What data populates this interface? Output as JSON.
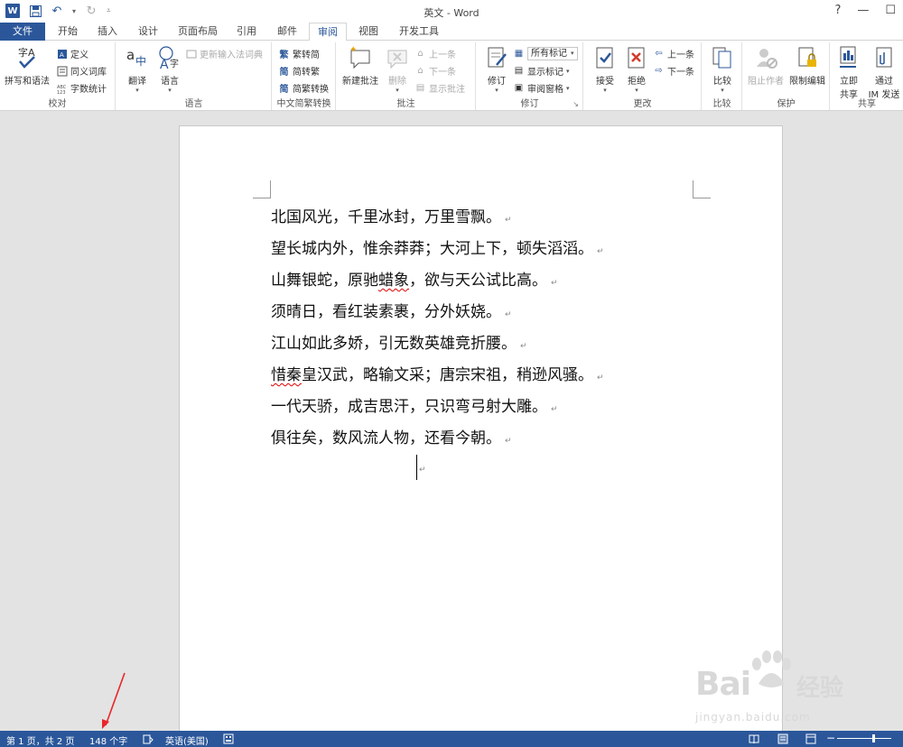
{
  "window": {
    "title": "英文 - Word",
    "help": "?",
    "minimize": "—",
    "maximize": "☐"
  },
  "tabs": [
    {
      "label": "文件"
    },
    {
      "label": "开始"
    },
    {
      "label": "插入"
    },
    {
      "label": "设计"
    },
    {
      "label": "页面布局"
    },
    {
      "label": "引用"
    },
    {
      "label": "邮件"
    },
    {
      "label": "审阅"
    },
    {
      "label": "视图"
    },
    {
      "label": "开发工具"
    }
  ],
  "ribbon": {
    "proofing": {
      "label": "校对",
      "spelling": "拼写和语法",
      "define": "定义",
      "thesaurus": "同义词库",
      "word_count": "字数统计"
    },
    "language": {
      "label": "语言",
      "translate": "翻译",
      "language": "语言",
      "update_ime": "更新输入法词典"
    },
    "chinese_conversion": {
      "label": "中文简繁转换",
      "to_simplified": "繁转简",
      "to_traditional": "简转繁",
      "convert": "简繁转换"
    },
    "comments": {
      "label": "批注",
      "new_comment": "新建批注",
      "delete": "删除",
      "previous": "上一条",
      "next": "下一条",
      "show_comments": "显示批注"
    },
    "tracking": {
      "label": "修订",
      "track_changes": "修订",
      "markup_select": "所有标记",
      "show_markup": "显示标记",
      "reviewing_pane": "审阅窗格"
    },
    "changes": {
      "label": "更改",
      "accept": "接受",
      "reject": "拒绝",
      "previous": "上一条",
      "next": "下一条"
    },
    "compare": {
      "label": "比较",
      "compare": "比较"
    },
    "protect": {
      "label": "保护",
      "block_authors": "阻止作者",
      "restrict_editing": "限制编辑"
    },
    "share": {
      "label": "共享",
      "share_now": "立即共享",
      "im_send_line1": "通过",
      "im_send_line2": "IM 发送",
      "share_now_line1": "立即",
      "share_now_line2": "共享"
    }
  },
  "document": {
    "lines": [
      {
        "text": "北国风光，千里冰封，万里雪飘。"
      },
      {
        "text": "望长城内外，惟余莽莽；大河上下，顿失滔滔。"
      },
      {
        "text_before": "山舞银蛇，原驰",
        "text_squiggle": "蜡象",
        "text_after": "，欲与天公试比高。"
      },
      {
        "text": "须晴日，看红装素裹，分外妖娆。"
      },
      {
        "text": "江山如此多娇，引无数英雄竞折腰。"
      },
      {
        "text_squiggle": "惜秦",
        "text_after": "皇汉武，略输文采；唐宗宋祖，稍逊风骚。"
      },
      {
        "text": "一代天骄，成吉思汗，只识弯弓射大雕。"
      },
      {
        "text": "俱往矣，数风流人物，还看今朝。"
      }
    ],
    "paragraph_mark": "↵"
  },
  "status": {
    "page": "第 1 页，共 2 页",
    "word_count": "148 个字",
    "language": "英语(美国)"
  },
  "watermark": {
    "brand": "Bai",
    "brand_cn": "经验",
    "url": "jingyan.baidu.com"
  },
  "colors": {
    "accent": "#2b579a",
    "annotation_arrow": "#e8262a"
  }
}
